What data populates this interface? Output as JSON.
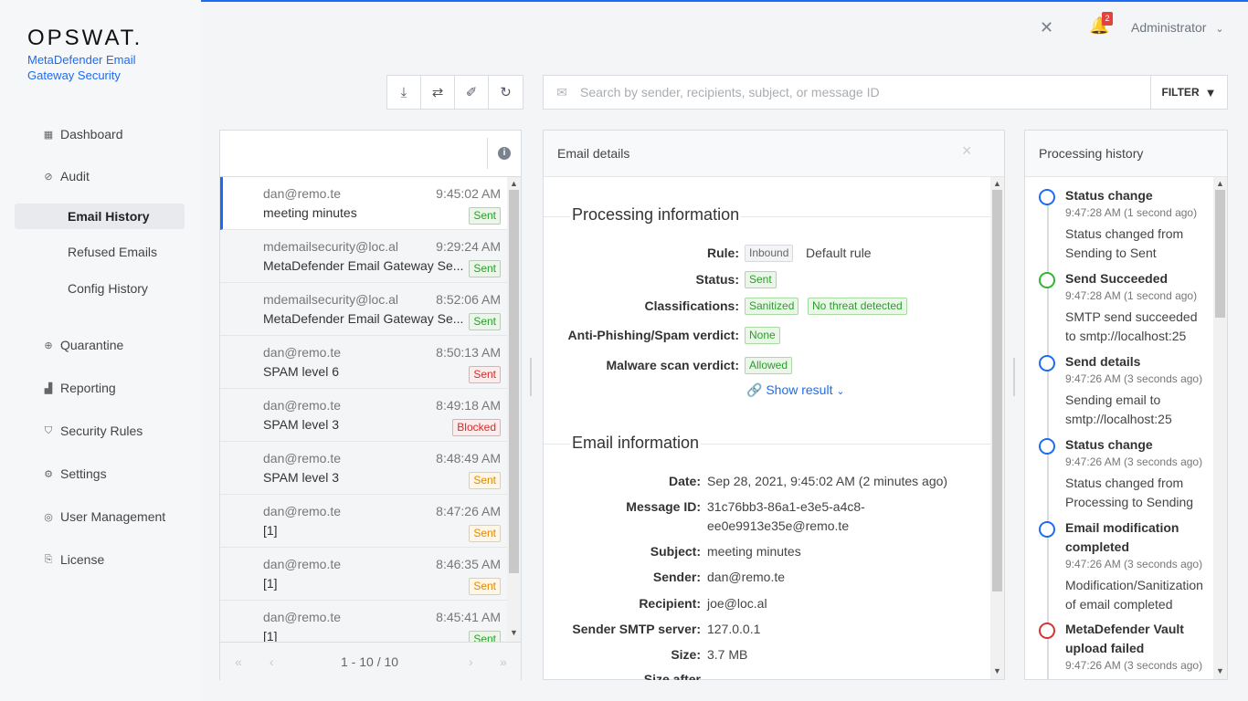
{
  "brand": {
    "logo": "OPSWAT.",
    "product": "MetaDefender Email Gateway Security"
  },
  "topbar": {
    "notification_count": "2",
    "user": "Administrator"
  },
  "nav": {
    "dashboard": "Dashboard",
    "audit": "Audit",
    "email_history": "Email History",
    "refused_emails": "Refused Emails",
    "config_history": "Config History",
    "quarantine": "Quarantine",
    "reporting": "Reporting",
    "security_rules": "Security Rules",
    "settings": "Settings",
    "user_management": "User Management",
    "license": "License"
  },
  "search": {
    "placeholder": "Search by sender, recipients, subject, or message ID",
    "filter_label": "FILTER"
  },
  "emails": [
    {
      "from": "dan@remo.te",
      "time": "9:45:02 AM",
      "subject": "meeting minutes",
      "status": "Sent",
      "status_color": "green"
    },
    {
      "from": "mdemailsecurity@loc.al",
      "time": "9:29:24 AM",
      "subject": "MetaDefender Email Gateway Se...",
      "status": "Sent",
      "status_color": "green"
    },
    {
      "from": "mdemailsecurity@loc.al",
      "time": "8:52:06 AM",
      "subject": "MetaDefender Email Gateway Se...",
      "status": "Sent",
      "status_color": "green"
    },
    {
      "from": "dan@remo.te",
      "time": "8:50:13 AM",
      "subject": "SPAM level 6",
      "status": "Sent",
      "status_color": "red"
    },
    {
      "from": "dan@remo.te",
      "time": "8:49:18 AM",
      "subject": "SPAM level 3",
      "status": "Blocked",
      "status_color": "red"
    },
    {
      "from": "dan@remo.te",
      "time": "8:48:49 AM",
      "subject": "SPAM level 3",
      "status": "Sent",
      "status_color": "orange"
    },
    {
      "from": "dan@remo.te",
      "time": "8:47:26 AM",
      "subject": "[1]",
      "status": "Sent",
      "status_color": "orange"
    },
    {
      "from": "dan@remo.te",
      "time": "8:46:35 AM",
      "subject": "[1]",
      "status": "Sent",
      "status_color": "orange"
    },
    {
      "from": "dan@remo.te",
      "time": "8:45:41 AM",
      "subject": "[1]",
      "status": "Sent",
      "status_color": "green"
    }
  ],
  "pager": {
    "info": "1 - 10 / 10",
    "first": "«",
    "prev": "‹",
    "next": "›",
    "last": "»"
  },
  "details": {
    "title": "Email details",
    "close": "×",
    "processing_title": "Processing information",
    "rule_label": "Rule:",
    "rule_tag": "Inbound",
    "rule_value": "Default rule",
    "status_label": "Status:",
    "status_value": "Sent",
    "classifications_label": "Classifications:",
    "classification_1": "Sanitized",
    "classification_2": "No threat detected",
    "phishing_label": "Anti-Phishing/Spam verdict:",
    "phishing_value": "None",
    "malware_label": "Malware scan verdict:",
    "malware_value": "Allowed",
    "show_result": "Show result",
    "email_info_title": "Email information",
    "date_label": "Date:",
    "date_value": "Sep 28, 2021, 9:45:02 AM (2 minutes ago)",
    "msgid_label": "Message ID:",
    "msgid_value_1": "31c76bb3-86a1-e3e5-a4c8-",
    "msgid_value_2": "ee0e9913e35e@remo.te",
    "subject_label": "Subject:",
    "subject_value": "meeting minutes",
    "sender_label": "Sender:",
    "sender_value": "dan@remo.te",
    "recipient_label": "Recipient:",
    "recipient_value": "joe@loc.al",
    "smtp_label": "Sender SMTP server:",
    "smtp_value": "127.0.0.1",
    "size_label": "Size:",
    "size_value": "3.7 MB",
    "size_after_label": "Size after"
  },
  "history": {
    "title": "Processing history",
    "items": [
      {
        "title": "Status change",
        "stamp": "9:47:28 AM (1 second ago)",
        "desc": "Status changed from Sending to Sent",
        "color": "#1d6bf3"
      },
      {
        "title": "Send Succeeded",
        "stamp": "9:47:28 AM (1 second ago)",
        "desc": "SMTP send succeeded to smtp://localhost:25",
        "color": "#2fb52f"
      },
      {
        "title": "Send details",
        "stamp": "9:47:26 AM (3 seconds ago)",
        "desc": "Sending email to smtp://localhost:25",
        "color": "#1d6bf3"
      },
      {
        "title": "Status change",
        "stamp": "9:47:26 AM (3 seconds ago)",
        "desc": "Status changed from Processing to Sending",
        "color": "#1d6bf3"
      },
      {
        "title": "Email modification completed",
        "stamp": "9:47:26 AM (3 seconds ago)",
        "desc": "Modification/Sanitization of email completed",
        "color": "#1d6bf3"
      },
      {
        "title": "MetaDefender Vault upload failed",
        "stamp": "9:47:26 AM (3 seconds ago)",
        "desc": "",
        "color": "#d63333"
      }
    ]
  }
}
